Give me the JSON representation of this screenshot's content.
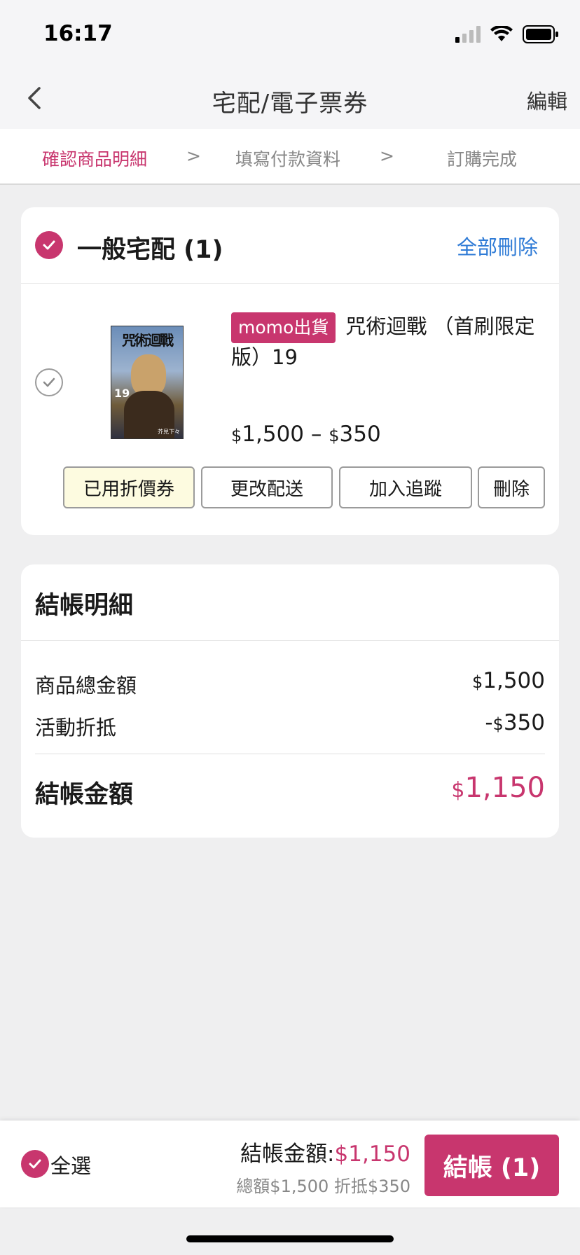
{
  "status_bar": {
    "time": "16:17"
  },
  "nav": {
    "title": "宅配/電子票券",
    "edit_label": "編輯"
  },
  "steps": {
    "step1": "確認商品明細",
    "step2": "填寫付款資料",
    "step3": "訂購完成",
    "separator": ">"
  },
  "cart_section": {
    "title": "一般宅配 (1)",
    "delete_all": "全部刪除",
    "item": {
      "tag": "momo出貨",
      "name": "咒術迴戰 （首刷限定版）19",
      "cover_title": "咒術迴戰",
      "cover_number": "19",
      "cover_author": "芥見下々",
      "price_original": "1,500",
      "price_separator": "–",
      "price_discount": "350",
      "currency": "$",
      "buttons": {
        "coupon": "已用折價券",
        "change_delivery": "更改配送",
        "add_tracking": "加入追蹤",
        "delete": "刪除"
      }
    }
  },
  "summary": {
    "title": "結帳明細",
    "subtotal_label": "商品總金額",
    "subtotal_value": "1,500",
    "discount_label": "活動折抵",
    "discount_prefix": "-",
    "discount_value": "350",
    "total_label": "結帳金額",
    "total_value": "1,150",
    "currency": "$"
  },
  "bottom_bar": {
    "select_all": "全選",
    "total_label": "結帳金額:",
    "total_value": "$1,150",
    "sub_text": "總額$1,500 折抵$350",
    "checkout_label": "結帳 (1)"
  },
  "colors": {
    "accent": "#c8366e",
    "link": "#2f7bd6",
    "coupon_bg": "#fdfbe0",
    "background": "#efeff0"
  }
}
